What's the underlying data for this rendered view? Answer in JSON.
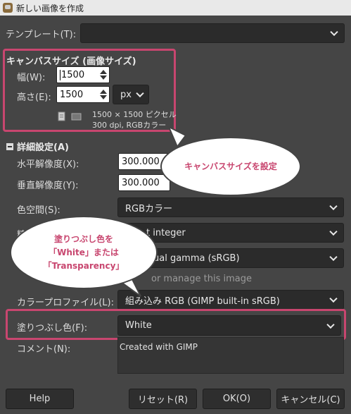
{
  "window": {
    "title": "新しい画像を作成"
  },
  "template": {
    "label": "テンプレート(T):",
    "value": ""
  },
  "canvas_size": {
    "heading": "キャンバスサイズ (画像サイズ)",
    "width_label": "幅(W):",
    "width_value": "1500",
    "height_label": "高さ(E):",
    "height_value": "1500",
    "unit": "px",
    "info_line1": "1500 × 1500 ピクセル",
    "info_line2": "300 dpi, RGBカラー"
  },
  "advanced": {
    "heading": "詳細設定(A)",
    "x_resolution_label": "水平解像度(X):",
    "x_resolution_value": "300.000",
    "y_resolution_label": "垂直解像度(Y):",
    "y_resolution_value": "300.000",
    "color_space_label": "色空間(S):",
    "color_space_value": "RGBカラー",
    "precision_label": "精度",
    "precision_value": "t integer",
    "gamma_value": "ual gamma (sRGB)",
    "manage_label": "or manage this image",
    "color_profile_label": "カラープロファイル(L):",
    "color_profile_value": "組み込み RGB (GIMP built-in sRGB)",
    "fill_label": "塗りつぶし色(F):",
    "fill_value": "White",
    "comment_label": "コメント(N):",
    "comment_value": "Created with GIMP"
  },
  "buttons": {
    "help": "Help",
    "reset": "リセット(R)",
    "ok": "OK(O)",
    "cancel": "キャンセル(C)"
  },
  "callouts": {
    "canvas": "キャンバスサイズを設定",
    "fill_line1": "塗りつぶし色を",
    "fill_line2": "「White」または「Transparency」"
  },
  "colors": {
    "highlight": "#c8466f",
    "dialog_bg": "#454545",
    "field_bg": "#2b2b2b"
  }
}
